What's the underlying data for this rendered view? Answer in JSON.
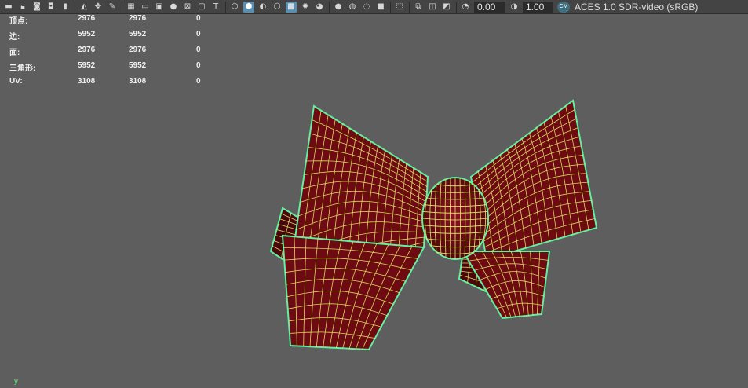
{
  "toolbar": {
    "exposure_value": "0.00",
    "gamma_value": "1.00",
    "colorspace_badge": "CM",
    "colorspace_label": "ACES 1.0 SDR-video (sRGB)",
    "icons": [
      "camera-icon",
      "lock-camera-icon",
      "camera-attributes-icon",
      "bookmark-icon",
      "image-plane-icon",
      "2d-pan-zoom-icon",
      "grease-pencil-icon",
      "grid-icon",
      "film-gate-icon",
      "resolution-gate-icon",
      "gate-mask-icon",
      "field-chart-icon",
      "safe-action-icon",
      "safe-title-icon",
      "wireframe-icon",
      "smooth-shade-icon",
      "default-material-icon",
      "wireframe-on-shaded-icon",
      "xray-icon",
      "use-all-lights-icon",
      "shadows-icon",
      "screen-space-ao-icon",
      "motion-blur-icon",
      "multisample-aa-icon",
      "depth-of-field-icon",
      "isolate-select-icon",
      "xray-joints-icon",
      "xray-active-components-icon",
      "exposure-icon",
      "gamma-icon",
      "color-management-icon"
    ],
    "active_icons": [
      "smooth-shade-icon",
      "wireframe-on-shaded-icon"
    ]
  },
  "hud": {
    "rows": [
      {
        "label": "顶点:",
        "v1": "2976",
        "v2": "2976",
        "v3": "0"
      },
      {
        "label": "边:",
        "v1": "5952",
        "v2": "5952",
        "v3": "0"
      },
      {
        "label": "面:",
        "v1": "2976",
        "v2": "2976",
        "v3": "0"
      },
      {
        "label": "三角形:",
        "v1": "5952",
        "v2": "5952",
        "v3": "0"
      },
      {
        "label": "UV:",
        "v1": "3108",
        "v2": "3108",
        "v3": "0"
      }
    ]
  },
  "viewport": {
    "axis_label": "y",
    "colors": {
      "background": "#5e5e5e",
      "mesh_fill": "#6e0a12",
      "mesh_fill_dark": "#4a060c",
      "wireframe": "#e6ee6a",
      "silhouette": "#5ff0a0"
    }
  }
}
